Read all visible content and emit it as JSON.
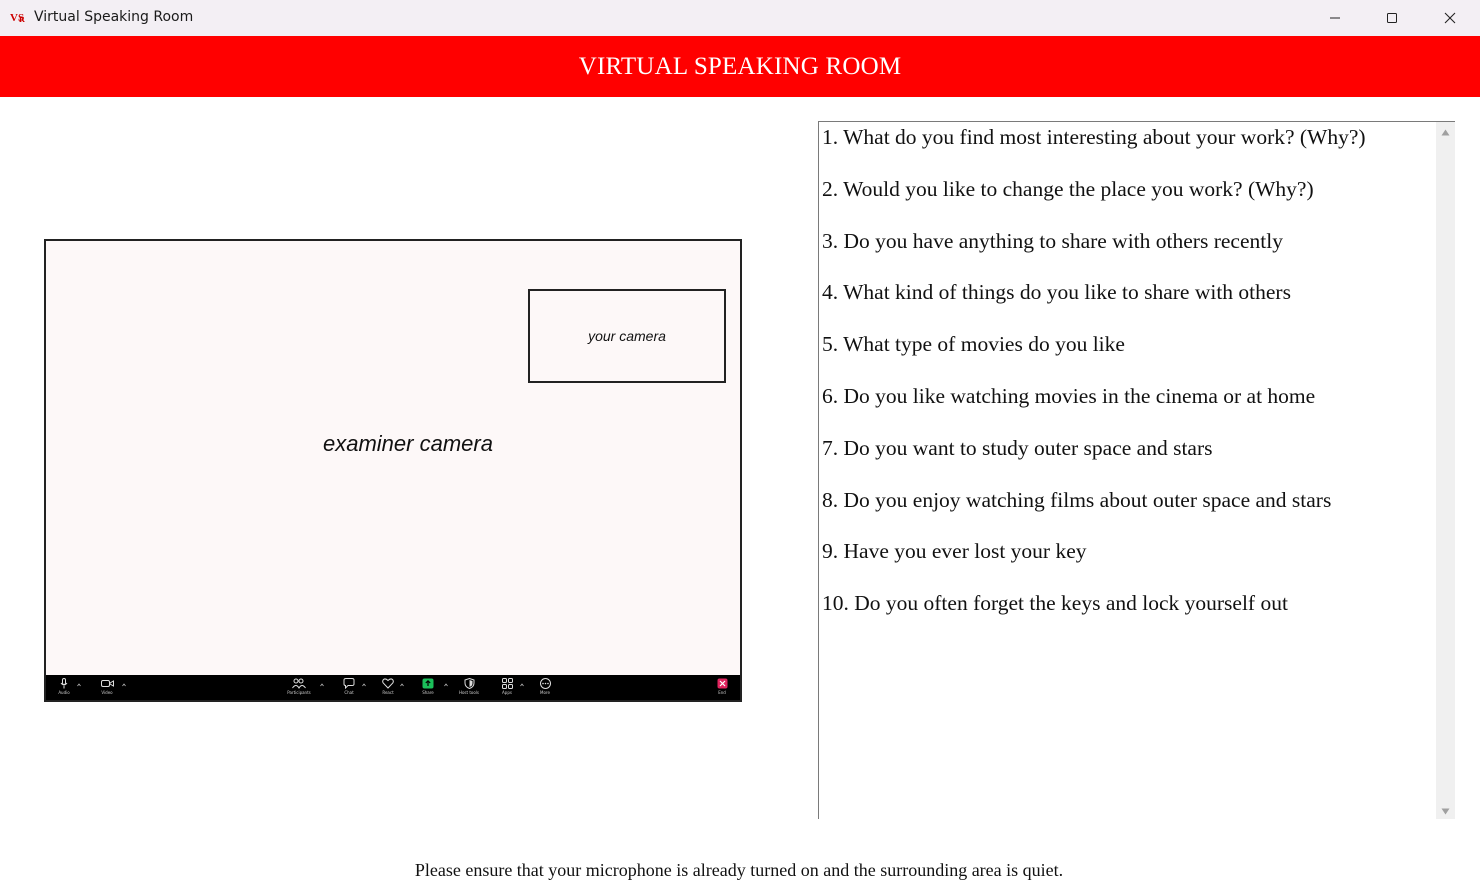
{
  "window": {
    "title": "Virtual Speaking Room",
    "icon_name": "app-logo-icon",
    "controls": [
      "minimize-icon",
      "maximize-icon",
      "close-icon"
    ]
  },
  "header": {
    "title": "VIRTUAL SPEAKING ROOM",
    "background": "#ff0000"
  },
  "meeting": {
    "self_camera_label": "your camera",
    "examiner_camera_label": "examiner camera",
    "toolbar": {
      "audio": "Audio",
      "video": "Video",
      "participants": "Participants",
      "chat": "Chat",
      "react": "React",
      "share": "Share",
      "host_tools": "Host tools",
      "apps": "Apps",
      "more": "More",
      "end": "End"
    }
  },
  "questions": [
    "1. What do you find most interesting about your work? (Why?)",
    "2. Would you like to change the place you work? (Why?)",
    "3. Do you have anything to share with others recently",
    "4. What kind of things do you like to share with others",
    "5. What type of movies do you like",
    "6. Do you like watching movies in the cinema or at home",
    "7. Do you want to study outer space and stars",
    "8. Do you enjoy watching films about outer space and stars",
    "9. Have you ever lost your key",
    "10. Do you often forget the keys and lock yourself out"
  ],
  "footer": {
    "note": "Please ensure that your microphone is already turned on and the surrounding area is quiet."
  }
}
